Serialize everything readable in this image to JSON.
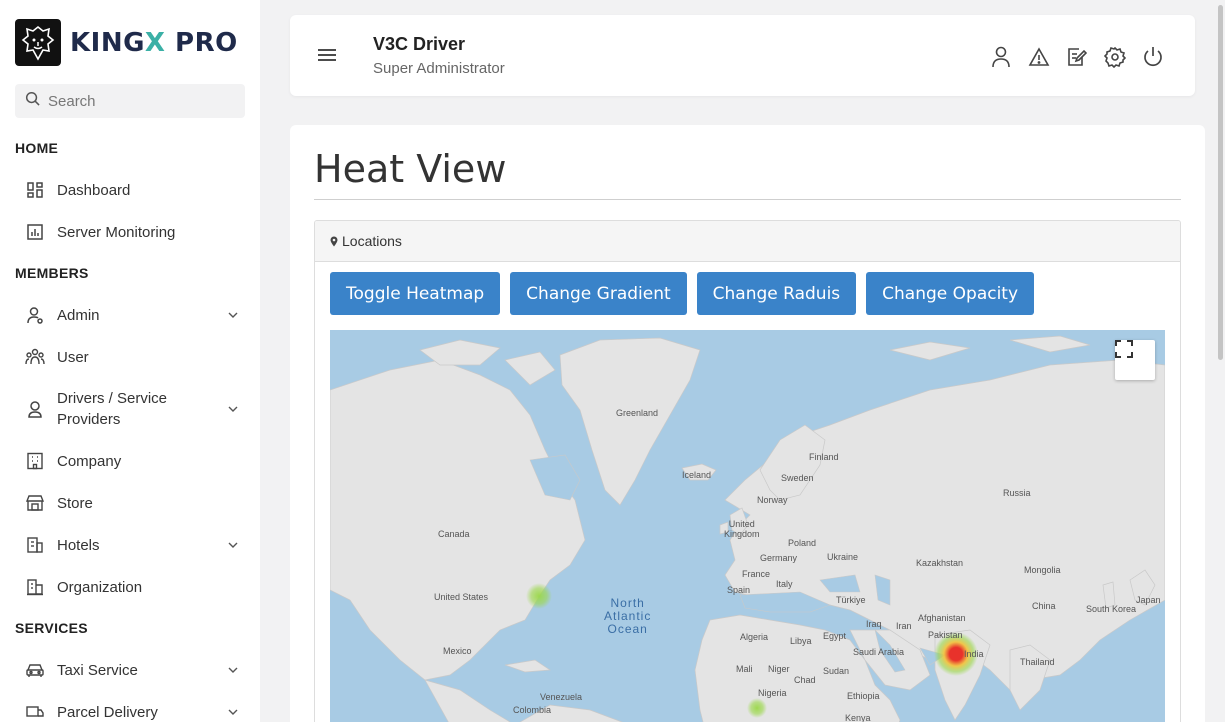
{
  "brand": {
    "name_a": "KING",
    "name_x": "X",
    "name_b": " PRO"
  },
  "search": {
    "placeholder": "Search"
  },
  "sidebar": {
    "sections": [
      "HOME",
      "MEMBERS",
      "SERVICES"
    ],
    "items": [
      {
        "label": "Dashboard",
        "icon": "dashboard-icon"
      },
      {
        "label": "Server Monitoring",
        "icon": "chart-icon"
      },
      {
        "label": "Admin",
        "icon": "admin-icon",
        "expandable": true
      },
      {
        "label": "User",
        "icon": "users-icon"
      },
      {
        "label": "Drivers / Service",
        "label2": "Providers",
        "icon": "driver-icon",
        "expandable": true
      },
      {
        "label": "Company",
        "icon": "building-icon"
      },
      {
        "label": "Store",
        "icon": "store-icon"
      },
      {
        "label": "Hotels",
        "icon": "hotel-icon",
        "expandable": true
      },
      {
        "label": "Organization",
        "icon": "organization-icon"
      },
      {
        "label": "Taxi Service",
        "icon": "taxi-icon",
        "expandable": true
      },
      {
        "label": "Parcel Delivery",
        "icon": "parcel-icon",
        "expandable": true
      }
    ]
  },
  "header": {
    "user_name": "V3C Driver",
    "user_role": "Super Administrator"
  },
  "main": {
    "title": "Heat View",
    "panel_title": "Locations",
    "buttons": [
      "Toggle Heatmap",
      "Change Gradient",
      "Change Raduis",
      "Change Opacity"
    ]
  },
  "map": {
    "ocean_label": [
      "North",
      "Atlantic",
      "Ocean"
    ],
    "labels": {
      "greenland": "Greenland",
      "iceland": "Iceland",
      "finland": "Finland",
      "sweden": "Sweden",
      "norway": "Norway",
      "russia": "Russia",
      "uk1": "United",
      "uk2": "Kingdom",
      "poland": "Poland",
      "germany": "Germany",
      "ukraine": "Ukraine",
      "france": "France",
      "italy": "Italy",
      "spain": "Spain",
      "kazakhstan": "Kazakhstan",
      "mongolia": "Mongolia",
      "turkiye": "Türkiye",
      "canada": "Canada",
      "us": "United States",
      "china": "China",
      "south_korea": "South Korea",
      "japan": "Japan",
      "afghanistan": "Afghanistan",
      "iraq": "Iraq",
      "iran": "Iran",
      "pakistan": "Pakistan",
      "algeria": "Algeria",
      "libya": "Libya",
      "egypt": "Egypt",
      "saudi": "Saudi Arabia",
      "india": "India",
      "thailand": "Thailand",
      "mexico": "Mexico",
      "mali": "Mali",
      "niger": "Niger",
      "chad": "Chad",
      "sudan": "Sudan",
      "venezuela": "Venezuela",
      "nigeria": "Nigeria",
      "ethiopia": "Ethiopia",
      "colombia": "Colombia",
      "kenya": "Kenya"
    },
    "colors": {
      "water": "#a8cbe4",
      "land": "#e4e4e4",
      "heat_hot": "#e8322b",
      "heat_mid": "#9bd84a"
    }
  }
}
